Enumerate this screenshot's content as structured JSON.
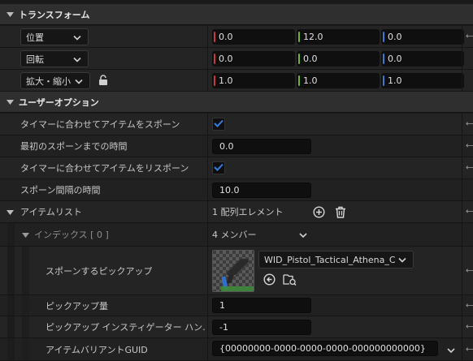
{
  "sections": {
    "transform": {
      "title": "トランスフォーム"
    },
    "user_options": {
      "title": "ユーザーオプション"
    }
  },
  "transform": {
    "location": {
      "label": "位置",
      "x": "0.0",
      "y": "12.0",
      "z": "0.0"
    },
    "rotation": {
      "label": "回転",
      "x": "0.0",
      "y": "0.0",
      "z": "0.0"
    },
    "scale": {
      "label": "拡大・縮小",
      "x": "1.0",
      "y": "1.0",
      "z": "1.0"
    }
  },
  "options": {
    "spawn_on_timer": {
      "label": "タイマーに合わせてアイテムをスポーン",
      "checked": true
    },
    "first_spawn_time": {
      "label": "最初のスポーンまでの時間",
      "value": "0.0"
    },
    "respawn_on_timer": {
      "label": "タイマーに合わせてアイテムをリスポーン",
      "checked": true
    },
    "spawn_interval": {
      "label": "スポーン間隔の時間",
      "value": "10.0"
    },
    "item_list": {
      "label": "アイテムリスト",
      "summary": "1 配列エレメント"
    },
    "index": {
      "label": "インデックス [ 0 ]",
      "members": "4 メンバー"
    },
    "pickup": {
      "label": "スポーンするピックアップ",
      "asset": "WID_Pistol_Tactical_Athena_C"
    },
    "pickup_count": {
      "label": "ピックアップ量",
      "value": "1"
    },
    "instigator": {
      "label": "ピックアップ インスティゲーター ハン…",
      "value": "-1"
    },
    "variant_guid": {
      "label": "アイテムバリアントGUID",
      "value": "{00000000-0000-0000-0000-000000000000}"
    }
  },
  "colors": {
    "x_axis": "#c83a3a",
    "y_axis": "#6fb52c",
    "z_axis": "#3a7ad6",
    "accent": "#2f7fe0"
  },
  "icons": [
    "chevron-down-icon",
    "lock-icon",
    "plus-circle-icon",
    "trash-icon",
    "checkmark-icon",
    "use-selected-icon",
    "browse-icon",
    "reset-arrow-icon"
  ]
}
